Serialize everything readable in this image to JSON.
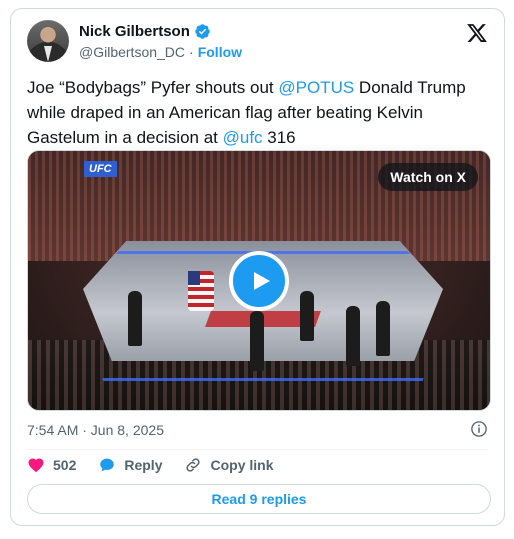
{
  "author": {
    "name": "Nick Gilbertson",
    "handle": "@Gilbertson_DC",
    "separator": "·",
    "follow_label": "Follow",
    "verified": true
  },
  "tweet": {
    "text_parts": [
      "Joe “Bodybags” Pyfer shouts out ",
      "@POTUS",
      " Donald Trump while draped in an American flag after beating Kelvin Gastelum in a decision at ",
      "@ufc",
      " 316"
    ]
  },
  "media": {
    "overlay_badge": "UFC",
    "watch_label": "Watch on X",
    "play_icon": "play-icon"
  },
  "meta": {
    "timestamp": "7:54 AM · Jun 8, 2025"
  },
  "actions": {
    "like_count": "502",
    "reply_label": "Reply",
    "copy_link_label": "Copy link"
  },
  "footer": {
    "read_replies_label": "Read 9 replies"
  },
  "colors": {
    "accent": "#1d9bf0",
    "like": "#f91880",
    "text": "#0f1419",
    "muted": "#536471",
    "border": "#cfd9de"
  }
}
